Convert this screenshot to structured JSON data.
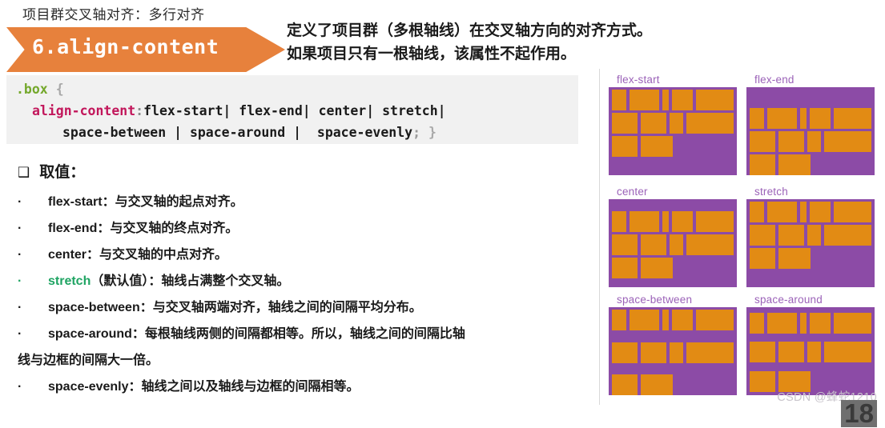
{
  "slide": {
    "kicker": "项目群交叉轴对齐：多行对齐",
    "banner_label": "6.align-content",
    "description_line1": "定义了项目群（多根轴线）在交叉轴方向的对齐方式。",
    "description_line2": "如果项目只有一根轴线，该属性不起作用。",
    "page_number": "18",
    "watermark": "CSDN @蜂蛇1210"
  },
  "code": {
    "selector": ".box",
    "brace_open": "{",
    "property": "align-content",
    "colon": ":",
    "values_line1": "flex-start| flex-end| center| stretch|",
    "values_line2": "space-between | space-around |  space-evenly",
    "semicolon": ";",
    "brace_close": "}"
  },
  "values_section": {
    "marker": "❑",
    "heading": "取值：",
    "items": [
      {
        "dot": "·",
        "text": "flex-start：与交叉轴的起点对齐。",
        "highlight": false
      },
      {
        "dot": "·",
        "text": "flex-end：与交叉轴的终点对齐。",
        "highlight": false
      },
      {
        "dot": "·",
        "text": "center：与交叉轴的中点对齐。",
        "highlight": false
      },
      {
        "dot": "·",
        "keyword": "stretch",
        "rest": "（默认值）：轴线占满整个交叉轴。",
        "highlight": true
      },
      {
        "dot": "·",
        "text": "space-between：与交叉轴两端对齐，轴线之间的间隔平均分布。",
        "highlight": false
      },
      {
        "dot": "·",
        "text": "space-around：每根轴线两侧的间隔都相等。所以，轴线之间的间隔比轴",
        "highlight": false
      }
    ],
    "continuation": "线与边框的间隔大一倍。",
    "last_item": {
      "dot": "·",
      "text": "space-evenly：轴线之间以及轴线与边框的间隔相等。",
      "highlight": false
    }
  },
  "demos": [
    {
      "title": "flex-start",
      "mode": "flex-start"
    },
    {
      "title": "flex-end",
      "mode": "flex-end"
    },
    {
      "title": "center",
      "mode": "center"
    },
    {
      "title": "stretch",
      "mode": "stretch"
    },
    {
      "title": "space-between",
      "mode": "space-between"
    },
    {
      "title": "space-around",
      "mode": "space-around"
    }
  ],
  "demo_rows": [
    [
      28,
      56,
      12,
      40,
      72
    ],
    [
      48,
      48,
      26,
      88
    ],
    [
      32,
      40
    ]
  ],
  "colors": {
    "orange_banner": "#E7813C",
    "orange_item": "#E28B14",
    "purple_box": "#8C4BA6",
    "purple_label": "#9B62B8",
    "code_bg": "#F1F1F1",
    "green_accent": "#1FA463"
  }
}
